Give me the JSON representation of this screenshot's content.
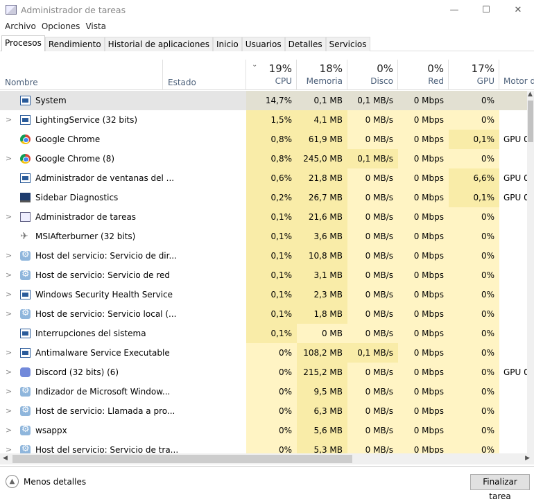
{
  "window": {
    "title": "Administrador de tareas",
    "minimize": "—",
    "maximize": "☐",
    "close": "✕"
  },
  "menu": [
    "Archivo",
    "Opciones",
    "Vista"
  ],
  "tabs": [
    "Procesos",
    "Rendimiento",
    "Historial de aplicaciones",
    "Inicio",
    "Usuarios",
    "Detalles",
    "Servicios"
  ],
  "columns": {
    "name": "Nombre",
    "status": "Estado",
    "cpu_pct": "19%",
    "cpu": "CPU",
    "mem_pct": "18%",
    "mem": "Memoria",
    "disk_pct": "0%",
    "disk": "Disco",
    "net_pct": "0%",
    "net": "Red",
    "gpu_pct": "17%",
    "gpu": "GPU",
    "engine": "Motor d"
  },
  "rows": [
    {
      "name": "System",
      "exp": false,
      "icon": "win",
      "cpu": "14,7%",
      "mem": "0,1 MB",
      "disk": "0,1 MB/s",
      "net": "0 Mbps",
      "gpu": "0%",
      "engine": "",
      "heat": [
        1,
        1,
        1,
        0,
        0
      ],
      "sel": true
    },
    {
      "name": "LightingService (32 bits)",
      "exp": true,
      "icon": "win",
      "cpu": "1,5%",
      "mem": "4,1 MB",
      "disk": "0 MB/s",
      "net": "0 Mbps",
      "gpu": "0%",
      "engine": "",
      "heat": [
        1,
        1,
        0,
        0,
        0
      ]
    },
    {
      "name": "Google Chrome",
      "exp": false,
      "icon": "chrome",
      "cpu": "0,8%",
      "mem": "61,9 MB",
      "disk": "0 MB/s",
      "net": "0 Mbps",
      "gpu": "0,1%",
      "engine": "GPU 0",
      "heat": [
        1,
        1,
        0,
        0,
        1
      ]
    },
    {
      "name": "Google Chrome (8)",
      "exp": true,
      "icon": "chrome",
      "cpu": "0,8%",
      "mem": "245,0 MB",
      "disk": "0,1 MB/s",
      "net": "0 Mbps",
      "gpu": "0%",
      "engine": "",
      "heat": [
        1,
        1,
        1,
        0,
        0
      ]
    },
    {
      "name": "Administrador de ventanas del ...",
      "exp": false,
      "icon": "win",
      "cpu": "0,6%",
      "mem": "21,8 MB",
      "disk": "0 MB/s",
      "net": "0 Mbps",
      "gpu": "6,6%",
      "engine": "GPU 0",
      "heat": [
        1,
        1,
        0,
        0,
        1
      ]
    },
    {
      "name": "Sidebar Diagnostics",
      "exp": false,
      "icon": "monitor",
      "cpu": "0,2%",
      "mem": "26,7 MB",
      "disk": "0 MB/s",
      "net": "0 Mbps",
      "gpu": "0,1%",
      "engine": "GPU 0",
      "heat": [
        1,
        1,
        0,
        0,
        1
      ]
    },
    {
      "name": "Administrador de tareas",
      "exp": true,
      "icon": "chart",
      "cpu": "0,1%",
      "mem": "21,6 MB",
      "disk": "0 MB/s",
      "net": "0 Mbps",
      "gpu": "0%",
      "engine": "",
      "heat": [
        1,
        1,
        0,
        0,
        0
      ]
    },
    {
      "name": "MSIAfterburner (32 bits)",
      "exp": false,
      "icon": "plane",
      "cpu": "0,1%",
      "mem": "3,6 MB",
      "disk": "0 MB/s",
      "net": "0 Mbps",
      "gpu": "0%",
      "engine": "",
      "heat": [
        1,
        1,
        0,
        0,
        0
      ]
    },
    {
      "name": "Host del servicio: Servicio de dir...",
      "exp": true,
      "icon": "gear",
      "cpu": "0,1%",
      "mem": "10,8 MB",
      "disk": "0 MB/s",
      "net": "0 Mbps",
      "gpu": "0%",
      "engine": "",
      "heat": [
        1,
        1,
        0,
        0,
        0
      ]
    },
    {
      "name": "Host de servicio: Servicio de red",
      "exp": true,
      "icon": "gear",
      "cpu": "0,1%",
      "mem": "3,1 MB",
      "disk": "0 MB/s",
      "net": "0 Mbps",
      "gpu": "0%",
      "engine": "",
      "heat": [
        1,
        1,
        0,
        0,
        0
      ]
    },
    {
      "name": "Windows Security Health Service",
      "exp": true,
      "icon": "win",
      "cpu": "0,1%",
      "mem": "2,3 MB",
      "disk": "0 MB/s",
      "net": "0 Mbps",
      "gpu": "0%",
      "engine": "",
      "heat": [
        1,
        1,
        0,
        0,
        0
      ]
    },
    {
      "name": "Host de servicio: Servicio local (...",
      "exp": true,
      "icon": "gear",
      "cpu": "0,1%",
      "mem": "1,8 MB",
      "disk": "0 MB/s",
      "net": "0 Mbps",
      "gpu": "0%",
      "engine": "",
      "heat": [
        1,
        1,
        0,
        0,
        0
      ]
    },
    {
      "name": "Interrupciones del sistema",
      "exp": false,
      "icon": "win",
      "cpu": "0,1%",
      "mem": "0 MB",
      "disk": "0 MB/s",
      "net": "0 Mbps",
      "gpu": "0%",
      "engine": "",
      "heat": [
        1,
        0,
        0,
        0,
        0
      ]
    },
    {
      "name": "Antimalware Service Executable",
      "exp": true,
      "icon": "win",
      "cpu": "0%",
      "mem": "108,2 MB",
      "disk": "0,1 MB/s",
      "net": "0 Mbps",
      "gpu": "0%",
      "engine": "",
      "heat": [
        0,
        1,
        1,
        0,
        0
      ]
    },
    {
      "name": "Discord (32 bits) (6)",
      "exp": true,
      "icon": "discord",
      "cpu": "0%",
      "mem": "215,2 MB",
      "disk": "0 MB/s",
      "net": "0 Mbps",
      "gpu": "0%",
      "engine": "GPU 0",
      "heat": [
        0,
        1,
        0,
        0,
        0
      ]
    },
    {
      "name": "Indizador de Microsoft Window...",
      "exp": true,
      "icon": "gear",
      "cpu": "0%",
      "mem": "9,5 MB",
      "disk": "0 MB/s",
      "net": "0 Mbps",
      "gpu": "0%",
      "engine": "",
      "heat": [
        0,
        1,
        0,
        0,
        0
      ]
    },
    {
      "name": "Host de servicio: Llamada a pro...",
      "exp": true,
      "icon": "gear",
      "cpu": "0%",
      "mem": "6,3 MB",
      "disk": "0 MB/s",
      "net": "0 Mbps",
      "gpu": "0%",
      "engine": "",
      "heat": [
        0,
        1,
        0,
        0,
        0
      ]
    },
    {
      "name": "wsappx",
      "exp": true,
      "icon": "gear",
      "cpu": "0%",
      "mem": "5,6 MB",
      "disk": "0 MB/s",
      "net": "0 Mbps",
      "gpu": "0%",
      "engine": "",
      "heat": [
        0,
        1,
        0,
        0,
        0
      ]
    },
    {
      "name": "Host del servicio: Servicio de tra...",
      "exp": true,
      "icon": "gear",
      "cpu": "0%",
      "mem": "5,3 MB",
      "disk": "0 MB/s",
      "net": "0 Mbps",
      "gpu": "0%",
      "engine": "",
      "heat": [
        0,
        1,
        0,
        0,
        0
      ]
    }
  ],
  "footer": {
    "less_details": "Menos detalles",
    "end_task": "Finalizar tarea"
  }
}
